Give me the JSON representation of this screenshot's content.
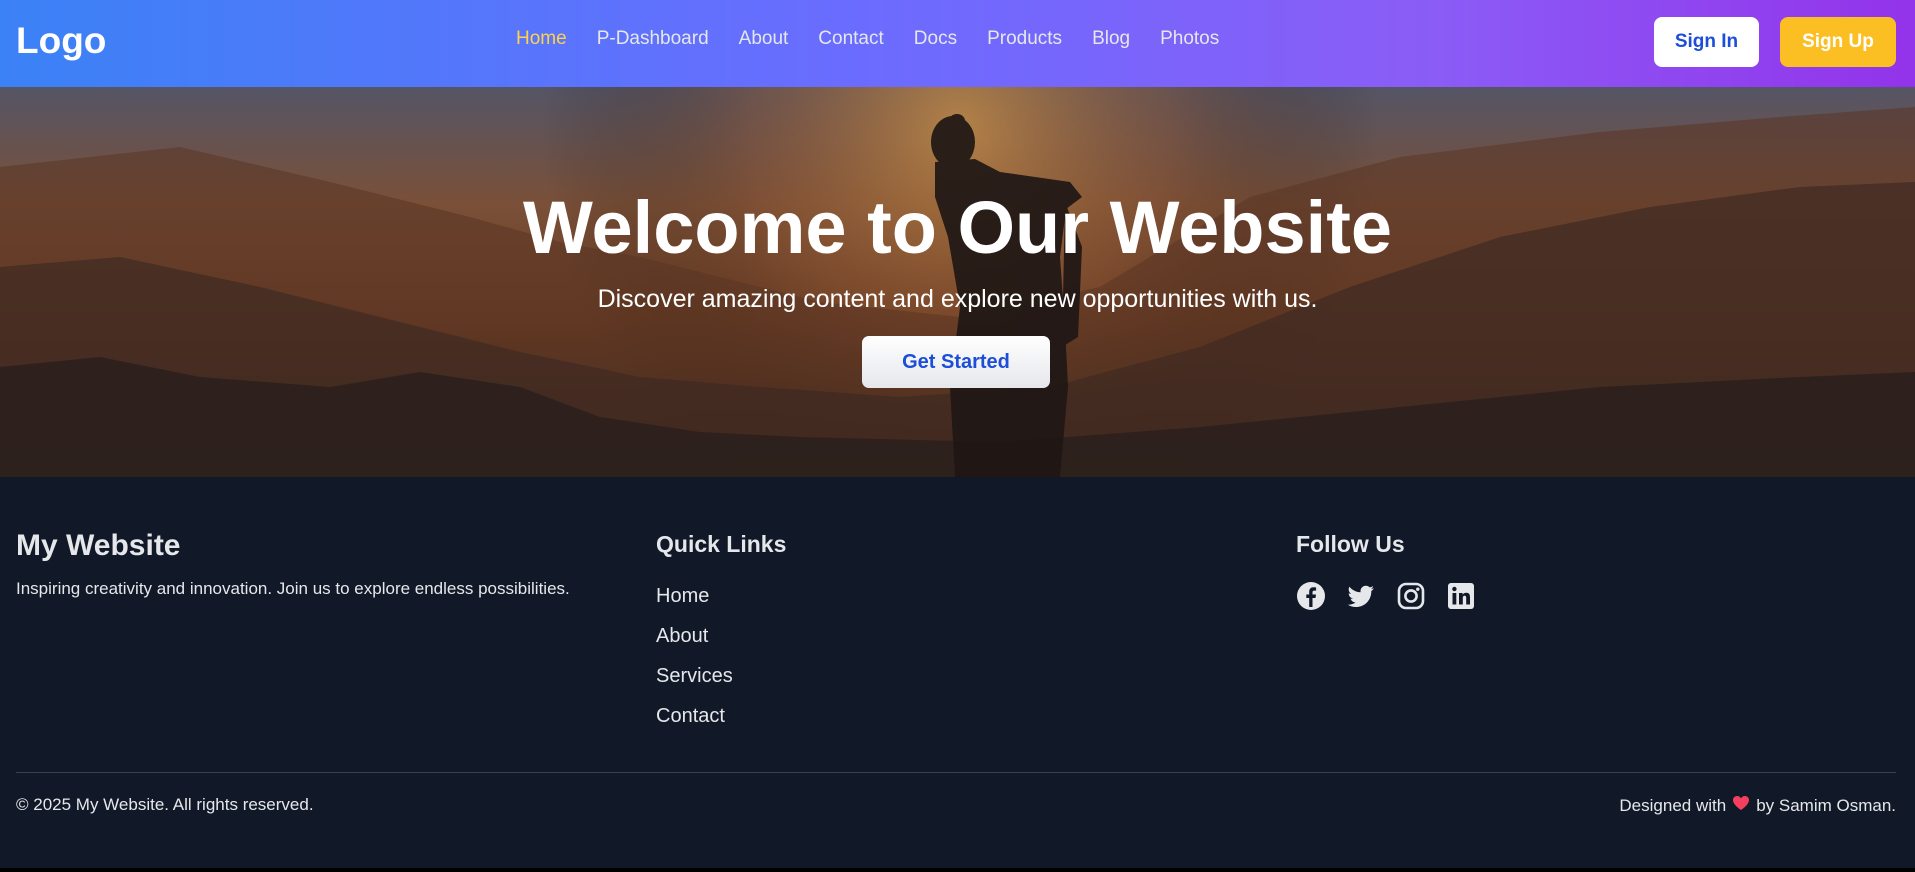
{
  "header": {
    "logo": "Logo",
    "nav": [
      {
        "label": "Home",
        "active": true
      },
      {
        "label": "P-Dashboard",
        "active": false
      },
      {
        "label": "About",
        "active": false
      },
      {
        "label": "Contact",
        "active": false
      },
      {
        "label": "Docs",
        "active": false
      },
      {
        "label": "Products",
        "active": false
      },
      {
        "label": "Blog",
        "active": false
      },
      {
        "label": "Photos",
        "active": false
      }
    ],
    "signin_label": "Sign In",
    "signup_label": "Sign Up"
  },
  "hero": {
    "title": "Welcome to Our Website",
    "subtitle": "Discover amazing content and explore new opportunities with us.",
    "cta_label": "Get Started"
  },
  "footer": {
    "brand_title": "My Website",
    "brand_desc": "Inspiring creativity and innovation. Join us to explore endless possibilities.",
    "quick_links_title": "Quick Links",
    "quick_links": [
      "Home",
      "About",
      "Services",
      "Contact"
    ],
    "follow_title": "Follow Us",
    "social_icons": [
      "facebook-icon",
      "twitter-icon",
      "instagram-icon",
      "linkedin-icon"
    ],
    "copyright": "© 2025 My Website. All rights reserved.",
    "credit_prefix": "Designed with",
    "credit_suffix": "by Samim Osman."
  },
  "colors": {
    "nav_active": "#fcd34d",
    "signup_bg": "#fbbf24",
    "footer_bg": "#111827",
    "cta_text": "#1d4ed8"
  }
}
